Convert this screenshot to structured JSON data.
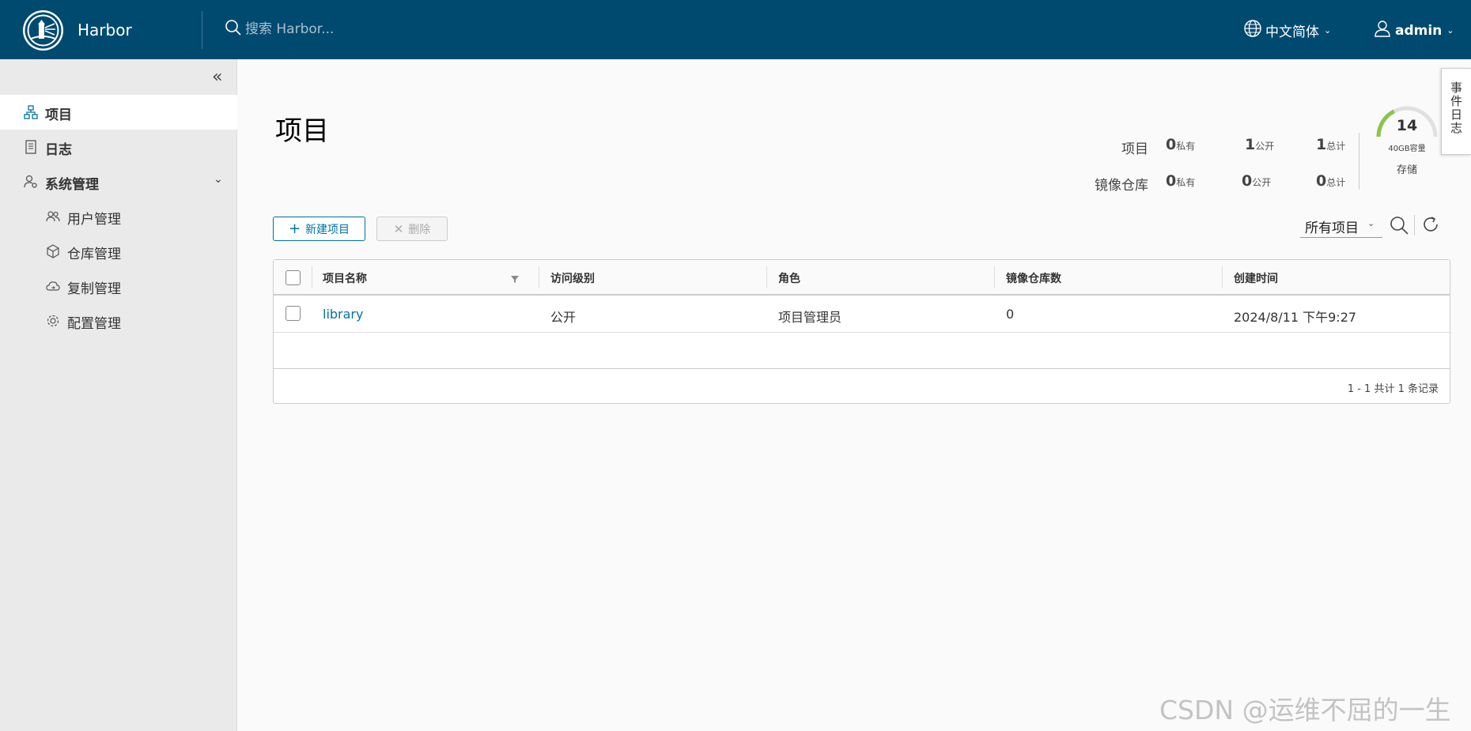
{
  "header": {
    "brand": "Harbor",
    "search_placeholder": "搜索 Harbor...",
    "language": "中文简体",
    "user": "admin",
    "bg_color": "#004a70"
  },
  "sidebar": {
    "items": [
      {
        "label": "项目",
        "icon": "project-icon",
        "active": true
      },
      {
        "label": "日志",
        "icon": "log-icon"
      },
      {
        "label": "系统管理",
        "icon": "admin-icon",
        "expanded": true
      }
    ],
    "sub_items": [
      {
        "label": "用户管理",
        "icon": "users-icon"
      },
      {
        "label": "仓库管理",
        "icon": "registry-icon"
      },
      {
        "label": "复制管理",
        "icon": "replication-icon"
      },
      {
        "label": "配置管理",
        "icon": "settings-icon"
      }
    ]
  },
  "main": {
    "title": "项目",
    "stats": {
      "rows": [
        {
          "label": "项目",
          "private": "0",
          "public": "1",
          "total": "1"
        },
        {
          "label": "镜像仓库",
          "private": "0",
          "public": "0",
          "total": "0"
        }
      ],
      "units": {
        "private": "私有",
        "public": "公开",
        "total": "总计"
      }
    },
    "gauge": {
      "value": "14",
      "capacity": "40GB容量",
      "label": "存储",
      "fraction": 0.35
    },
    "event_log": "事件日志",
    "buttons": {
      "new": "新建项目",
      "delete": "删除"
    },
    "filter": "所有项目",
    "table": {
      "columns": [
        "项目名称",
        "访问级别",
        "角色",
        "镜像仓库数",
        "创建时间"
      ],
      "rows": [
        {
          "name": "library",
          "access": "公开",
          "role": "项目管理员",
          "repos": "0",
          "created": "2024/8/11 下午9:27"
        }
      ],
      "pagination": "1 - 1 共计 1 条记录"
    }
  },
  "watermark": "CSDN @运维不屈的一生"
}
